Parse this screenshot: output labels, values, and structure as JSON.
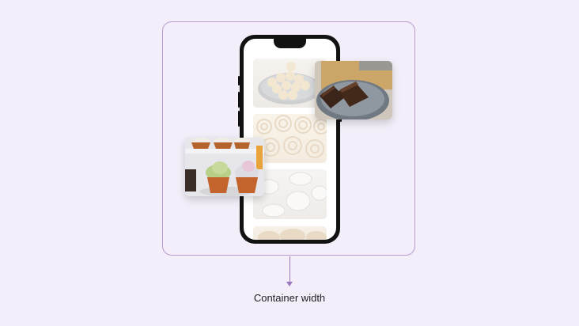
{
  "diagram": {
    "caption": "Container width",
    "colors": {
      "background": "#f3eef9",
      "container_border": "#b99ad0",
      "arrow": "#9b76bd",
      "phone_body": "#121212",
      "caption_text": "#1e1e24"
    },
    "phone": {
      "feed_cards": [
        "pastry-balls-photo",
        "cinnamon-rolls-photo",
        "dough-pieces-photo",
        "bread-photo"
      ],
      "feed_opacity": 0.42
    },
    "floating_cards": [
      "brownies-photo",
      "cupcakes-photo"
    ],
    "icons": [
      "down-arrow-icon"
    ]
  }
}
